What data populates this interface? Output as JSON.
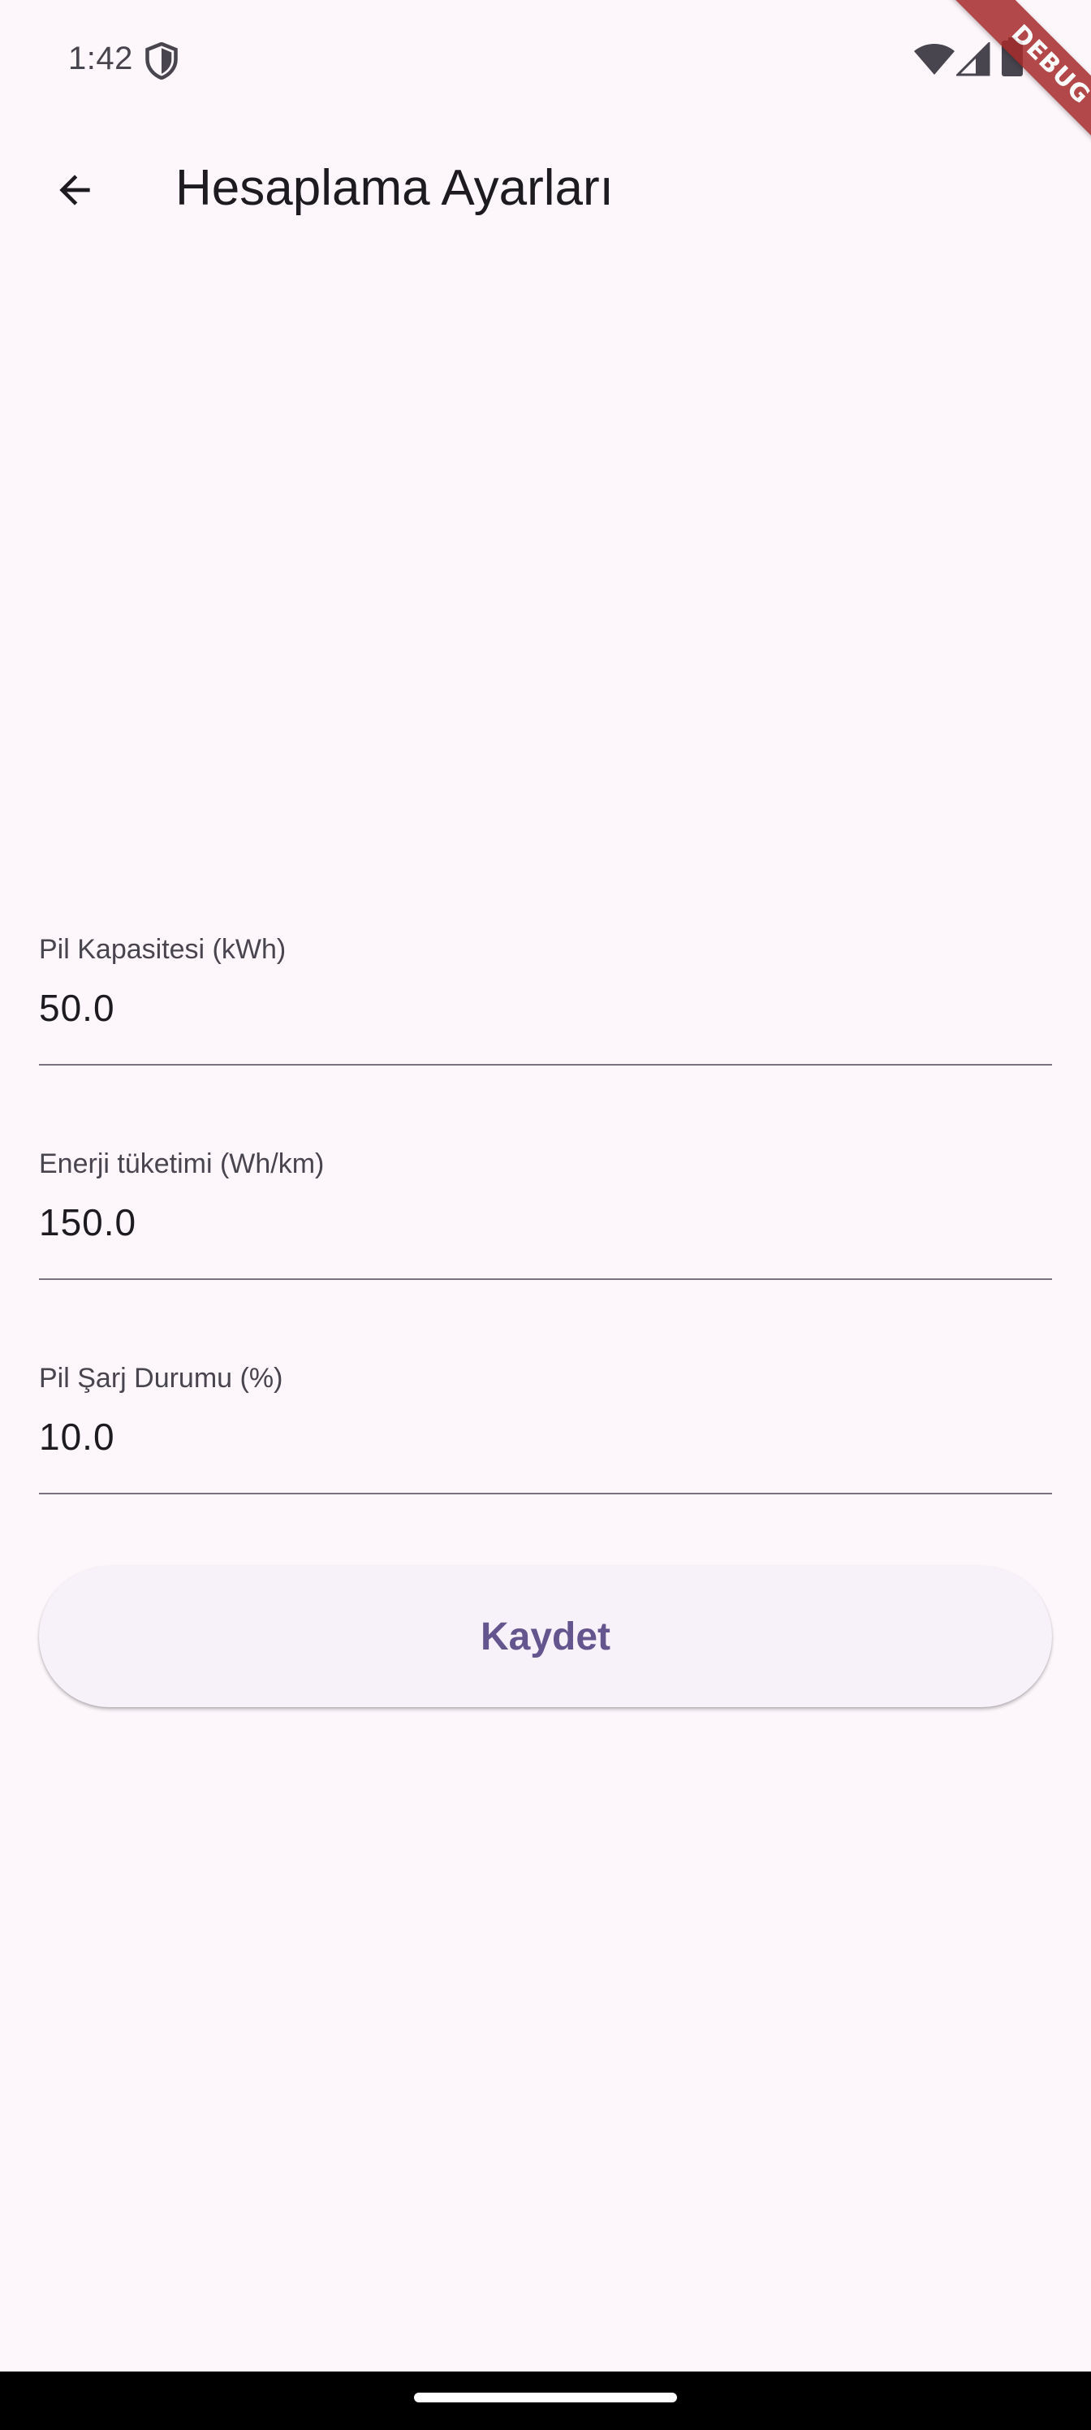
{
  "status_bar": {
    "time": "1:42",
    "icons": [
      "shield-icon",
      "wifi-icon",
      "cellular-signal-icon",
      "battery-icon"
    ]
  },
  "debug_banner": {
    "label": "DEBUG",
    "color": "#a52a2a"
  },
  "app_bar": {
    "title": "Hesaplama Ayarları",
    "back_icon": "arrow-back-icon"
  },
  "form": {
    "fields": [
      {
        "label": "Pil Kapasitesi (kWh)",
        "value": "50.0"
      },
      {
        "label": "Enerji tüketimi (Wh/km)",
        "value": "150.0"
      },
      {
        "label": "Pil Şarj Durumu (%)",
        "value": "10.0"
      }
    ],
    "save_label": "Kaydet"
  },
  "colors": {
    "background": "#fdf7fc",
    "primary": "#65558f",
    "button_surface": "#f7f2fa",
    "outline": "#79747e"
  }
}
